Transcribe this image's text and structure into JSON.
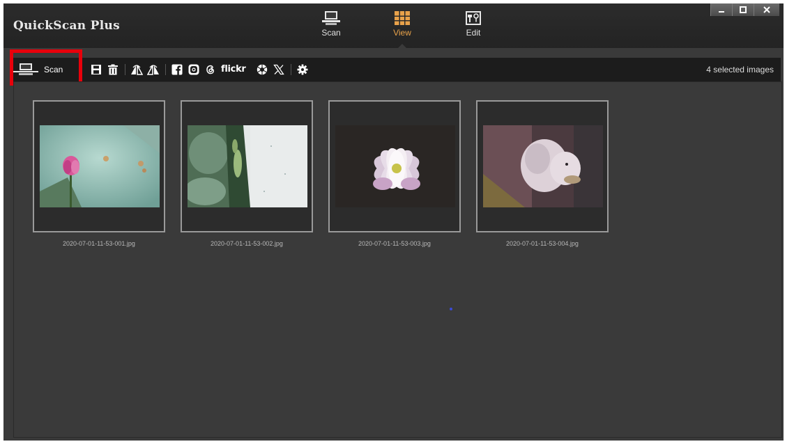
{
  "app": {
    "title": "QuickScan Plus"
  },
  "mode_tabs": [
    {
      "label": "Scan",
      "icon": "scanner-icon",
      "active": false
    },
    {
      "label": "View",
      "icon": "grid-icon",
      "active": true
    },
    {
      "label": "Edit",
      "icon": "edit-tools-icon",
      "active": false
    }
  ],
  "window_controls": [
    "minimize-icon",
    "maximize-icon",
    "close-icon"
  ],
  "toolbar": {
    "scan_label": "Scan",
    "tools": [
      "save-icon",
      "trash-icon",
      "flip-horizontal-icon",
      "flip-vertical-icon",
      "facebook-icon",
      "instagram-icon",
      "threads-icon",
      "flickr-logo",
      "picasa-icon",
      "x-icon",
      "gear-icon"
    ],
    "flickr_text": "flickr",
    "selected_count": "4 selected images"
  },
  "thumbnails": [
    {
      "filename": "2020-07-01-11-53-001.jpg"
    },
    {
      "filename": "2020-07-01-11-53-002.jpg"
    },
    {
      "filename": "2020-07-01-11-53-003.jpg"
    },
    {
      "filename": "2020-07-01-11-53-004.jpg"
    }
  ],
  "colors": {
    "accent": "#e8a24a",
    "highlight": "#e8000b",
    "window_bg": "#3a3a3a",
    "toolbar_bg": "#1c1c1c"
  }
}
